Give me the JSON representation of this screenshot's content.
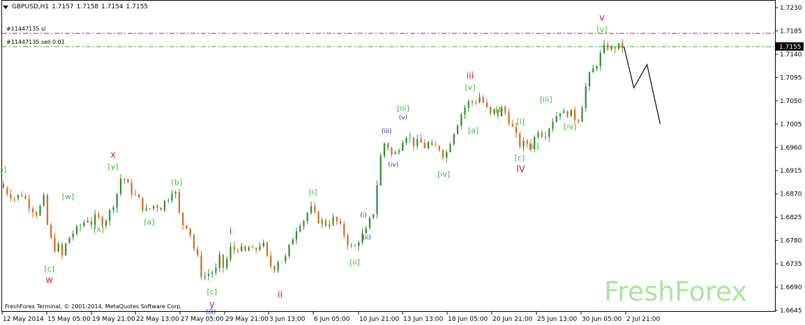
{
  "header": {
    "symbol_timeframe": "GBPUSD,H1",
    "open": "1.7157",
    "high": "1.7158",
    "low": "1.7154",
    "close": "1.7155"
  },
  "orders": {
    "stop_loss_label": "#11447135 sl",
    "sell_label": "#11447135 sell 0.01"
  },
  "footer": {
    "copyright": "FreshForex Terminal, © 2001-2014, MetaQuotes Software Corp."
  },
  "watermark": "FreshForex",
  "colors": {
    "stop_loss_line": "#c8141e",
    "sell_line": "#2fa32f",
    "bull_candle": "#2e8b2e",
    "bear_candle": "#d2691e",
    "wave_green": "#3cb83c",
    "wave_red": "#d81e1e",
    "wave_blue": "#2828b4",
    "price_tag_bg": "#000000"
  },
  "chart_data": {
    "type": "line",
    "title": "GBPUSD,H1",
    "ylim": [
      1.6645,
      1.723
    ],
    "y_ticks": [
      "1.7230",
      "1.7185",
      "1.7140",
      "1.7095",
      "1.7050",
      "1.7005",
      "1.6960",
      "1.6915",
      "1.6870",
      "1.6825",
      "1.6780",
      "1.6735",
      "1.6690",
      "1.6645"
    ],
    "current_price": "1.7155",
    "x_ticks": [
      "12 May 2014",
      "15 May 05:00",
      "19 May 21:00",
      "22 May 13:00",
      "27 May 05:00",
      "29 May 21:00",
      "3 Jun 13:00",
      "6 Jun 05:00",
      "10 Jun 21:00",
      "13 Jun 13:00",
      "18 Jun 05:00",
      "20 Jun 21:00",
      "25 Jun 13:00",
      "30 Jun 05:00",
      "2 Jul 21:00"
    ],
    "price_path": [
      [
        0,
        1.689
      ],
      [
        0.3,
        1.6875
      ],
      [
        0.7,
        1.6862
      ],
      [
        1.0,
        1.687
      ],
      [
        1.4,
        1.6845
      ],
      [
        1.7,
        1.6832
      ],
      [
        2.0,
        1.686
      ],
      [
        2.2,
        1.68
      ],
      [
        2.45,
        1.6765
      ],
      [
        2.7,
        1.6768
      ],
      [
        2.85,
        1.6748
      ],
      [
        3.0,
        1.6772
      ],
      [
        3.2,
        1.679
      ],
      [
        3.5,
        1.68
      ],
      [
        3.8,
        1.6815
      ],
      [
        4.0,
        1.6822
      ],
      [
        4.2,
        1.6812
      ],
      [
        4.4,
        1.6828
      ],
      [
        4.6,
        1.6815
      ],
      [
        4.8,
        1.682
      ],
      [
        5.0,
        1.6835
      ],
      [
        5.2,
        1.6855
      ],
      [
        5.4,
        1.688
      ],
      [
        5.55,
        1.691
      ],
      [
        5.7,
        1.6895
      ],
      [
        5.9,
        1.688
      ],
      [
        6.1,
        1.687
      ],
      [
        6.3,
        1.686
      ],
      [
        6.5,
        1.6845
      ],
      [
        6.7,
        1.6835
      ],
      [
        6.9,
        1.6845
      ],
      [
        7.1,
        1.685
      ],
      [
        7.3,
        1.6842
      ],
      [
        7.5,
        1.6855
      ],
      [
        7.7,
        1.6865
      ],
      [
        7.85,
        1.688
      ],
      [
        8.0,
        1.687
      ],
      [
        8.1,
        1.684
      ],
      [
        8.3,
        1.6812
      ],
      [
        8.5,
        1.681
      ],
      [
        8.7,
        1.679
      ],
      [
        8.85,
        1.6762
      ],
      [
        9.0,
        1.6745
      ],
      [
        9.2,
        1.671
      ],
      [
        9.4,
        1.6712
      ],
      [
        9.6,
        1.672
      ],
      [
        9.8,
        1.6718
      ],
      [
        10.0,
        1.6745
      ],
      [
        10.2,
        1.6725
      ],
      [
        10.4,
        1.6752
      ],
      [
        10.55,
        1.677
      ],
      [
        10.7,
        1.676
      ],
      [
        10.9,
        1.677
      ],
      [
        11.1,
        1.6752
      ],
      [
        11.3,
        1.6768
      ],
      [
        11.5,
        1.6758
      ],
      [
        11.7,
        1.6765
      ],
      [
        11.9,
        1.6778
      ],
      [
        12.05,
        1.6765
      ],
      [
        12.2,
        1.674
      ],
      [
        12.45,
        1.6725
      ],
      [
        12.7,
        1.6745
      ],
      [
        12.95,
        1.674
      ],
      [
        13.2,
        1.677
      ],
      [
        13.45,
        1.68
      ],
      [
        13.65,
        1.6815
      ],
      [
        13.9,
        1.6822
      ],
      [
        14.1,
        1.6845
      ],
      [
        14.3,
        1.683
      ],
      [
        14.5,
        1.682
      ],
      [
        14.7,
        1.6815
      ],
      [
        14.9,
        1.681
      ],
      [
        15.1,
        1.6822
      ],
      [
        15.3,
        1.6818
      ],
      [
        15.5,
        1.6805
      ],
      [
        15.7,
        1.679
      ],
      [
        15.9,
        1.677
      ],
      [
        16.1,
        1.6762
      ],
      [
        16.3,
        1.678
      ],
      [
        16.5,
        1.679
      ],
      [
        16.7,
        1.68
      ],
      [
        16.85,
        1.682
      ],
      [
        17.0,
        1.6835
      ],
      [
        17.1,
        1.686
      ],
      [
        17.25,
        1.6925
      ],
      [
        17.4,
        1.6955
      ],
      [
        17.55,
        1.6975
      ],
      [
        17.7,
        1.6958
      ],
      [
        17.9,
        1.694
      ],
      [
        18.1,
        1.6955
      ],
      [
        18.3,
        1.6975
      ],
      [
        18.5,
        1.6985
      ],
      [
        18.7,
        1.6975
      ],
      [
        18.9,
        1.6965
      ],
      [
        19.1,
        1.6972
      ],
      [
        19.3,
        1.696
      ],
      [
        19.5,
        1.6968
      ],
      [
        19.7,
        1.6955
      ],
      [
        19.9,
        1.6962
      ],
      [
        20.1,
        1.6955
      ],
      [
        20.25,
        1.6938
      ],
      [
        20.4,
        1.696
      ],
      [
        20.6,
        1.6985
      ],
      [
        20.8,
        1.7005
      ],
      [
        21.0,
        1.7025
      ],
      [
        21.2,
        1.704
      ],
      [
        21.4,
        1.705
      ],
      [
        21.6,
        1.7045
      ],
      [
        21.8,
        1.706
      ],
      [
        21.95,
        1.705
      ],
      [
        22.1,
        1.704
      ],
      [
        22.3,
        1.702
      ],
      [
        22.5,
        1.703
      ],
      [
        22.7,
        1.7022
      ],
      [
        22.85,
        1.7035
      ],
      [
        23.0,
        1.7028
      ],
      [
        23.15,
        1.7015
      ],
      [
        23.3,
        1.7
      ],
      [
        23.45,
        1.6985
      ],
      [
        23.6,
        1.697
      ],
      [
        23.75,
        1.696
      ],
      [
        23.95,
        1.6975
      ],
      [
        24.1,
        1.6955
      ],
      [
        24.3,
        1.6975
      ],
      [
        24.5,
        1.6995
      ],
      [
        24.7,
        1.6985
      ],
      [
        24.9,
        1.699
      ],
      [
        25.1,
        1.701
      ],
      [
        25.3,
        1.702
      ],
      [
        25.5,
        1.7032
      ],
      [
        25.7,
        1.7022
      ],
      [
        25.9,
        1.703
      ],
      [
        26.1,
        1.702
      ],
      [
        26.3,
        1.7012
      ],
      [
        26.45,
        1.703
      ],
      [
        26.6,
        1.7068
      ],
      [
        26.8,
        1.7095
      ],
      [
        27.0,
        1.711
      ],
      [
        27.2,
        1.7125
      ],
      [
        27.4,
        1.7145
      ],
      [
        27.6,
        1.7158
      ],
      [
        27.8,
        1.7148
      ],
      [
        28.0,
        1.7155
      ],
      [
        28.1,
        1.7163
      ],
      [
        28.2,
        1.715
      ],
      [
        28.3,
        1.7155
      ]
    ],
    "projection_path": [
      [
        28.3,
        1.7155
      ],
      [
        28.75,
        1.7075
      ],
      [
        29.35,
        1.712
      ],
      [
        29.95,
        1.7005
      ]
    ],
    "wave_labels": [
      {
        "text": "v",
        "color": "red",
        "x": 27.3,
        "y": 1.7205
      },
      {
        "text": "[v]",
        "color": "green",
        "x": 27.3,
        "y": 1.7183
      },
      {
        "text": "iii",
        "color": "red",
        "x": 21.3,
        "y": 1.7093
      },
      {
        "text": "[v]",
        "color": "green",
        "x": 21.3,
        "y": 1.7071
      },
      {
        "text": "[iii]",
        "color": "green",
        "x": 18.25,
        "y": 1.703
      },
      {
        "text": "(v)",
        "color": "blue",
        "x": 18.25,
        "y": 1.7014
      },
      {
        "text": "(iii)",
        "color": "blue",
        "x": 17.5,
        "y": 1.6988
      },
      {
        "text": "(iv)",
        "color": "blue",
        "x": 17.8,
        "y": 1.6923
      },
      {
        "text": "[a]",
        "color": "green",
        "x": 21.45,
        "y": 1.6988
      },
      {
        "text": "[b]",
        "color": "green",
        "x": 22.7,
        "y": 1.7028
      },
      {
        "text": "[iv]",
        "color": "green",
        "x": 20.1,
        "y": 1.6903
      },
      {
        "text": "[iii]",
        "color": "green",
        "x": 24.75,
        "y": 1.7048
      },
      {
        "text": "[i]",
        "color": "green",
        "x": 23.6,
        "y": 1.7005
      },
      {
        "text": "[ii]",
        "color": "green",
        "x": 24.2,
        "y": 1.6957
      },
      {
        "text": "[c]",
        "color": "green",
        "x": 23.55,
        "y": 1.6935
      },
      {
        "text": "IV",
        "color": "red",
        "x": 23.6,
        "y": 1.6912
      },
      {
        "text": "[iv]",
        "color": "green",
        "x": 25.85,
        "y": 1.6995
      },
      {
        "text": "x",
        "color": "red",
        "x": 5.05,
        "y": 1.694
      },
      {
        "text": "[y]",
        "color": "green",
        "x": 5.05,
        "y": 1.6918
      },
      {
        "text": "[b]",
        "color": "green",
        "x": 7.95,
        "y": 1.6888
      },
      {
        "text": "[w]",
        "color": "green",
        "x": 3.0,
        "y": 1.686
      },
      {
        "text": "[x]",
        "color": "green",
        "x": 4.4,
        "y": 1.6797
      },
      {
        "text": "[a]",
        "color": "green",
        "x": 6.7,
        "y": 1.6811
      },
      {
        "text": "[c]",
        "color": "green",
        "x": 2.15,
        "y": 1.672
      },
      {
        "text": "w",
        "color": "red",
        "x": 2.15,
        "y": 1.6698
      },
      {
        "text": "[c]",
        "color": "green",
        "x": 9.55,
        "y": 1.6676
      },
      {
        "text": "y",
        "color": "red",
        "x": 9.55,
        "y": 1.6651
      },
      {
        "text": "(iii)",
        "color": "blue",
        "x": 9.5,
        "y": 1.6638
      },
      {
        "text": "i",
        "color": "red",
        "x": 10.4,
        "y": 1.6792
      },
      {
        "text": "ii",
        "color": "red",
        "x": 12.65,
        "y": 1.667
      },
      {
        "text": "[i]",
        "color": "green",
        "x": 14.15,
        "y": 1.6868
      },
      {
        "text": "(i)",
        "color": "blue",
        "x": 16.45,
        "y": 1.6825
      },
      {
        "text": "(ii)",
        "color": "blue",
        "x": 16.6,
        "y": 1.6782
      },
      {
        "text": "[ii]",
        "color": "green",
        "x": 16.05,
        "y": 1.6733
      },
      {
        "text": "[b]",
        "color": "green",
        "x": -0.05,
        "y": 1.6912
      }
    ]
  }
}
